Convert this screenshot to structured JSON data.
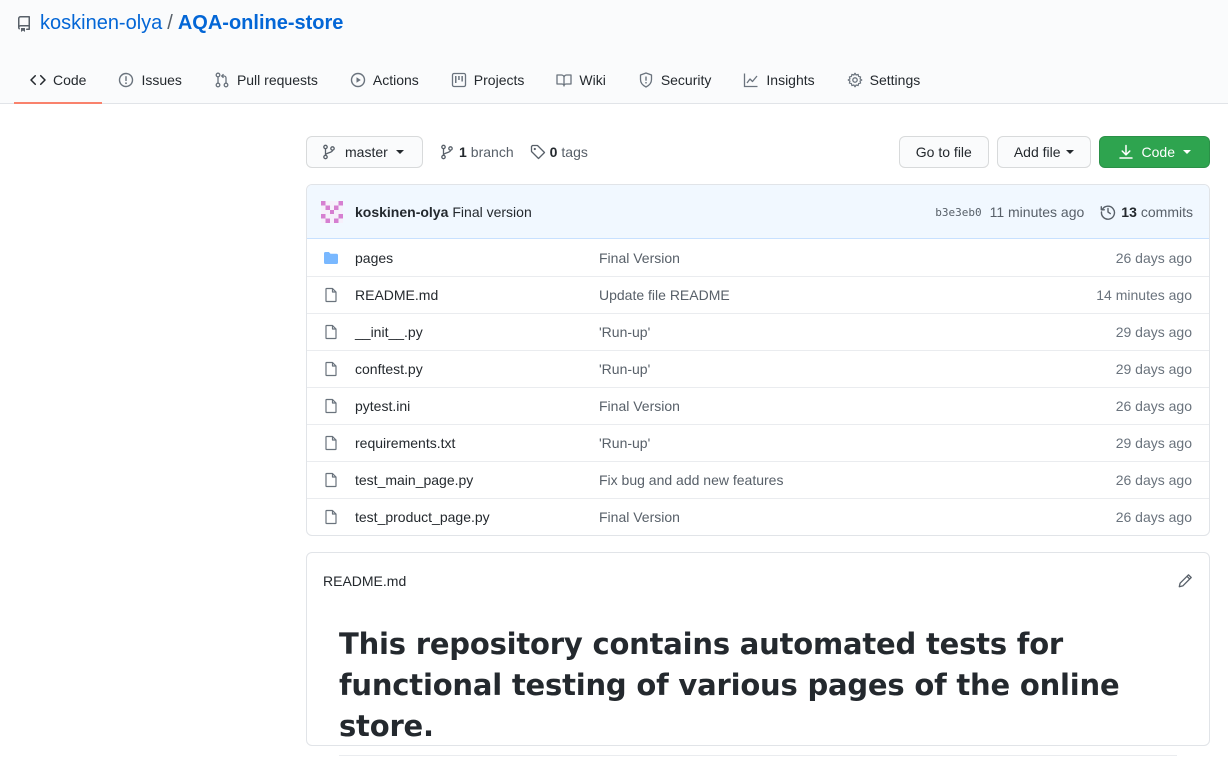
{
  "repo": {
    "owner": "koskinen-olya",
    "separator": "/",
    "name": "AQA-online-store"
  },
  "tabs": [
    {
      "label": "Code",
      "icon": "code-icon",
      "selected": true
    },
    {
      "label": "Issues",
      "icon": "issue-icon"
    },
    {
      "label": "Pull requests",
      "icon": "pull-request-icon"
    },
    {
      "label": "Actions",
      "icon": "play-icon"
    },
    {
      "label": "Projects",
      "icon": "project-icon"
    },
    {
      "label": "Wiki",
      "icon": "book-icon"
    },
    {
      "label": "Security",
      "icon": "shield-icon"
    },
    {
      "label": "Insights",
      "icon": "graph-icon"
    },
    {
      "label": "Settings",
      "icon": "gear-icon"
    }
  ],
  "toolbar": {
    "branch": "master",
    "branch_count": "1",
    "branch_label": "branch",
    "tag_count": "0",
    "tag_label": "tags",
    "go_to_file": "Go to file",
    "add_file": "Add file",
    "code": "Code"
  },
  "commit": {
    "author": "koskinen-olya",
    "message": "Final version",
    "sha": "b3e3eb0",
    "time": "11 minutes ago",
    "count": "13",
    "count_label": "commits"
  },
  "files": [
    {
      "name": "pages",
      "type": "dir",
      "message": "Final Version",
      "age": "26 days ago"
    },
    {
      "name": "README.md",
      "type": "file",
      "message": "Update file README",
      "age": "14 minutes ago"
    },
    {
      "name": "__init__.py",
      "type": "file",
      "message": "'Run-up'",
      "age": "29 days ago"
    },
    {
      "name": "conftest.py",
      "type": "file",
      "message": "'Run-up'",
      "age": "29 days ago"
    },
    {
      "name": "pytest.ini",
      "type": "file",
      "message": "Final Version",
      "age": "26 days ago"
    },
    {
      "name": "requirements.txt",
      "type": "file",
      "message": "'Run-up'",
      "age": "29 days ago"
    },
    {
      "name": "test_main_page.py",
      "type": "file",
      "message": "Fix bug and add new features",
      "age": "26 days ago"
    },
    {
      "name": "test_product_page.py",
      "type": "file",
      "message": "Final Version",
      "age": "26 days ago"
    }
  ],
  "readme": {
    "filename": "README.md",
    "heading": "This repository contains automated tests for functional testing of various pages of the online store."
  },
  "colors": {
    "link": "#0366d6",
    "tab_underline": "#f9826c",
    "green_button": "#2ea44f",
    "commit_bar": "#f1f8ff",
    "folder": "#79b8ff"
  }
}
